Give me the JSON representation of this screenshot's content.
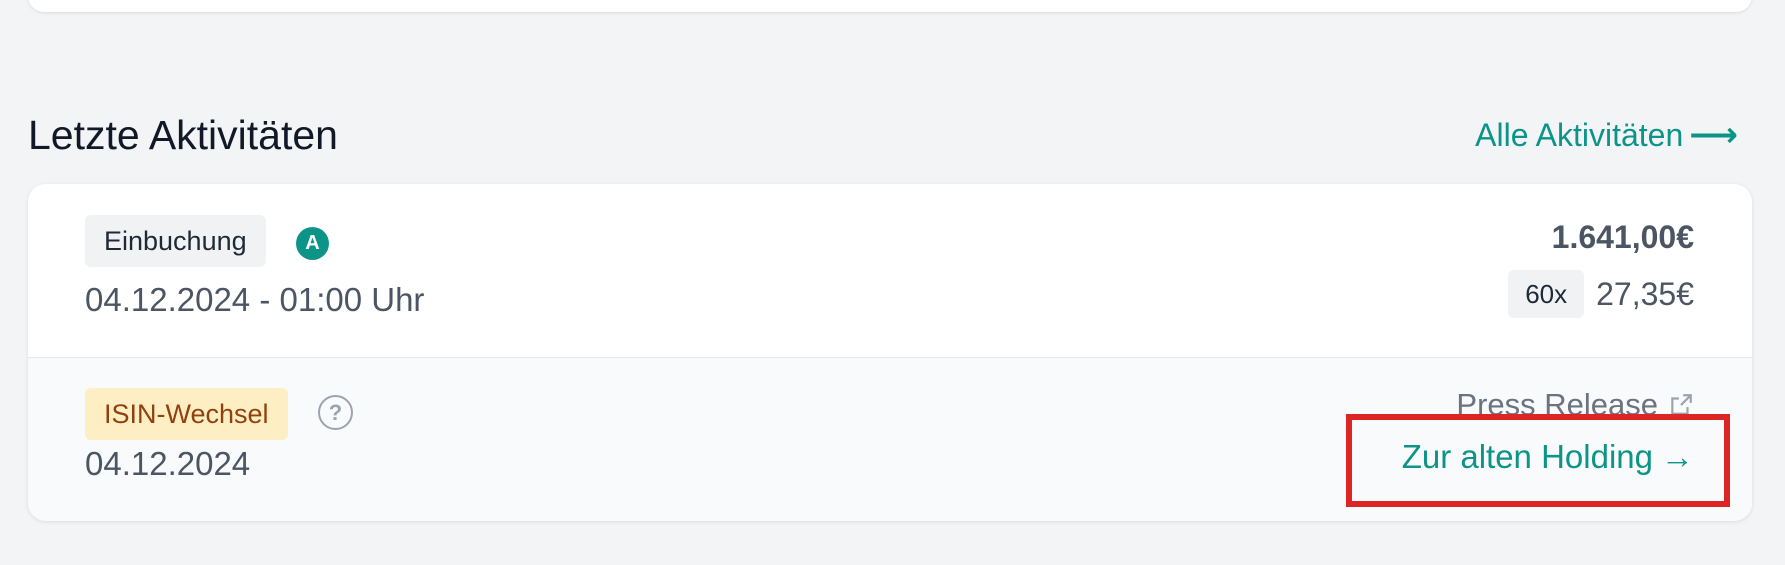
{
  "section": {
    "title": "Letzte Aktivitäten",
    "all_link_label": "Alle Aktivitäten",
    "all_link_arrow": "⟶"
  },
  "activities": [
    {
      "type_label": "Einbuchung",
      "account_badge": "A",
      "date": "04.12.2024 - 01:00 Uhr",
      "amount": "1.641,00€",
      "quantity": "60x",
      "unit_price": "27,35€"
    },
    {
      "type_label": "ISIN-Wechsel",
      "help_icon": "?",
      "date": "04.12.2024",
      "press_release_label": "Press Release",
      "old_holding_label": "Zur alten Holding",
      "old_holding_arrow": "→"
    }
  ],
  "colors": {
    "accent": "#0d9488",
    "highlight": "#dc2626",
    "isin_badge_bg": "#fdefc3",
    "isin_badge_text": "#92400e"
  }
}
